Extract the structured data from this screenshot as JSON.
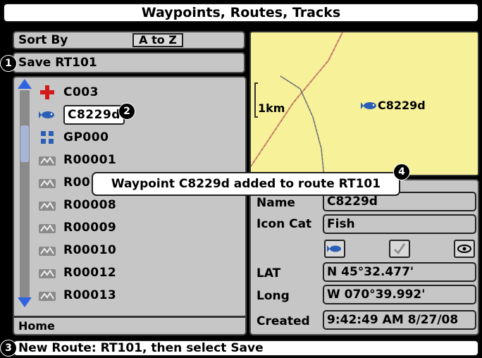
{
  "title": "Waypoints, Routes, Tracks",
  "sort": {
    "label": "Sort By",
    "value": "A to Z"
  },
  "save_route": "Save RT101",
  "list": {
    "items": [
      {
        "label": "C003",
        "icon": "cross-icon"
      },
      {
        "label": "C8229d",
        "icon": "fish-icon",
        "selected": true
      },
      {
        "label": "GP000",
        "icon": "grid-icon"
      },
      {
        "label": "R00001",
        "icon": "route-icon"
      },
      {
        "label": "R00",
        "icon": "route-icon"
      },
      {
        "label": "R00008",
        "icon": "route-icon"
      },
      {
        "label": "R00009",
        "icon": "route-icon"
      },
      {
        "label": "R00010",
        "icon": "route-icon"
      },
      {
        "label": "R00012",
        "icon": "route-icon"
      },
      {
        "label": "R00013",
        "icon": "route-icon"
      }
    ],
    "home": "Home"
  },
  "map": {
    "scale": "1km",
    "waypoint": "C8229d"
  },
  "info": {
    "name_label": "Name",
    "name_value": "C8229d",
    "iconcat_label": "Icon Cat",
    "iconcat_value": "Fish",
    "lat_label": "LAT",
    "lat_value": "N 45°32.477'",
    "long_label": "Long",
    "long_value": "W 070°39.992'",
    "created_label": "Created",
    "created_value": "9:42:49 AM 8/27/08"
  },
  "popup": "Waypoint C8229d added to route RT101",
  "status": "New Route: RT101, then select Save",
  "badges": {
    "b1": "1",
    "b2": "2",
    "b3": "3",
    "b4": "4"
  },
  "colors": {
    "panel": "#c6c6c6",
    "map": "#f7f19a",
    "scroll_arrow": "#2f63e0",
    "route_line": "#b04f52"
  }
}
